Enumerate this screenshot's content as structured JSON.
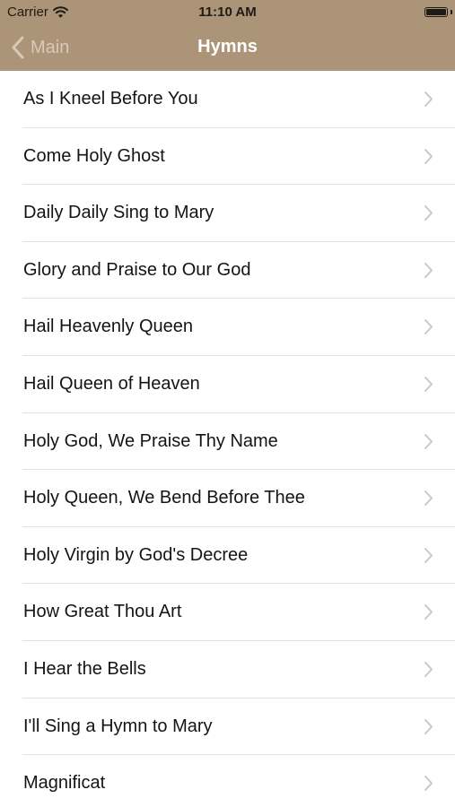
{
  "colors": {
    "nav_background": "#ac9478",
    "back_label": "#d8cab8",
    "title": "#ffffff",
    "row_text": "#141414",
    "separator": "#e3e3e3",
    "chevron": "#c7c7cc"
  },
  "status_bar": {
    "carrier": "Carrier",
    "time": "11:10 AM",
    "wifi_icon": "wifi-icon",
    "battery_icon": "battery-icon",
    "battery_level": 1.0
  },
  "nav": {
    "back_icon": "chevron-left-icon",
    "back_label": "Main",
    "title": "Hymns"
  },
  "hymns": [
    {
      "title": "As I Kneel Before You"
    },
    {
      "title": "Come Holy Ghost"
    },
    {
      "title": "Daily Daily Sing to Mary"
    },
    {
      "title": "Glory and Praise to Our God"
    },
    {
      "title": "Hail Heavenly Queen"
    },
    {
      "title": "Hail Queen of Heaven"
    },
    {
      "title": "Holy God, We Praise Thy Name"
    },
    {
      "title": "Holy Queen, We Bend Before Thee"
    },
    {
      "title": "Holy Virgin by God's Decree"
    },
    {
      "title": "How Great Thou Art"
    },
    {
      "title": "I Hear the Bells"
    },
    {
      "title": "I'll Sing a Hymn to Mary"
    },
    {
      "title": "Magnificat"
    }
  ]
}
